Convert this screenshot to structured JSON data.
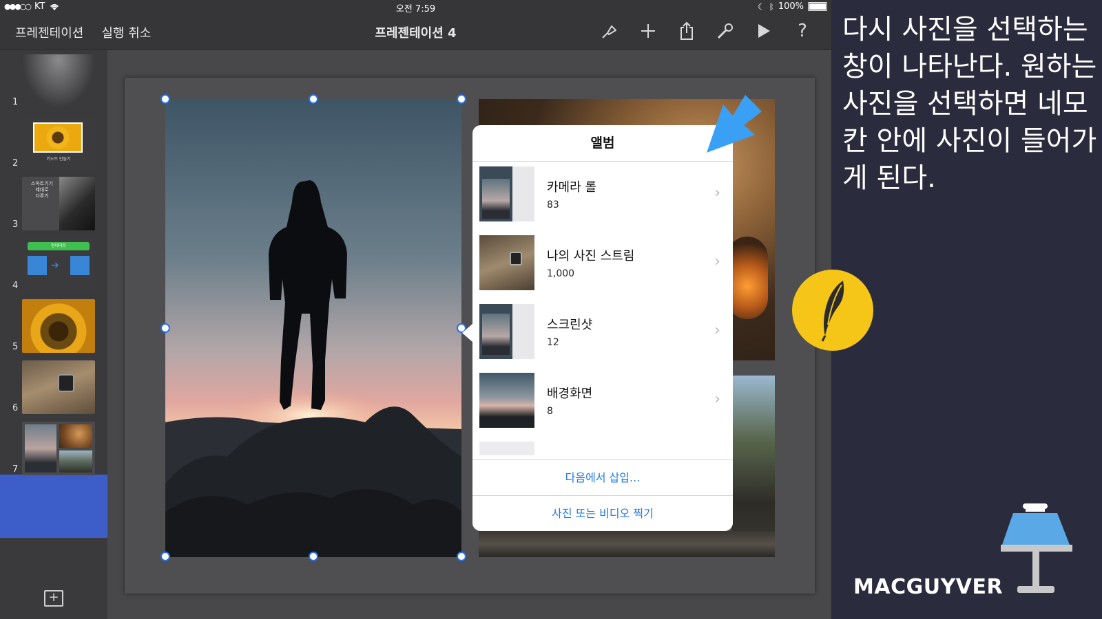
{
  "status_bar": {
    "carrier": "KT",
    "time": "오전 7:59",
    "battery": "100%"
  },
  "nav": {
    "left_items": [
      "프레젠테이션",
      "실행 취소"
    ],
    "title": "프레젠테이션 4",
    "icons": [
      "format-brush-icon",
      "add-icon",
      "share-icon",
      "wrench-icon",
      "play-icon",
      "help-icon"
    ],
    "help_label": "?"
  },
  "sidebar": {
    "slides": [
      {
        "number": "1",
        "desc": "dark gradient"
      },
      {
        "number": "2",
        "desc": "sunflower title",
        "caption": "키노트 만들기"
      },
      {
        "number": "3",
        "desc": "smart device",
        "caption_lines": [
          "스마트기기",
          "제대로",
          "다루기"
        ]
      },
      {
        "number": "4",
        "desc": "diagram",
        "badge": "업데이트"
      },
      {
        "number": "5",
        "desc": "sunflower closeup"
      },
      {
        "number": "6",
        "desc": "watch on wrist"
      },
      {
        "number": "7",
        "desc": "photo collage",
        "selected": true
      }
    ],
    "add_label": "+"
  },
  "popover": {
    "title": "앨범",
    "albums": [
      {
        "name": "카메라 롤",
        "count": "83"
      },
      {
        "name": "나의 사진 스트림",
        "count": "1,000"
      },
      {
        "name": "스크린샷",
        "count": "12"
      },
      {
        "name": "배경화면",
        "count": "8"
      }
    ],
    "actions": [
      "다음에서 삽입...",
      "사진 또는 비디오 찍기"
    ]
  },
  "info": {
    "text": "다시 사진을 선택하는 창이 나타난다. 원하는 사진을 선택하면 네모칸 안에 사진이 들어가게 된다.",
    "brand": "MACGUYVER"
  },
  "colors": {
    "accent_blue": "#1f7ae0",
    "selection": "#3d5ec9",
    "panel_bg": "#2a2b3d",
    "badge_yellow": "#f5c518",
    "arrow_blue": "#3aa0f5",
    "keynote_blue": "#5aa9e6"
  }
}
